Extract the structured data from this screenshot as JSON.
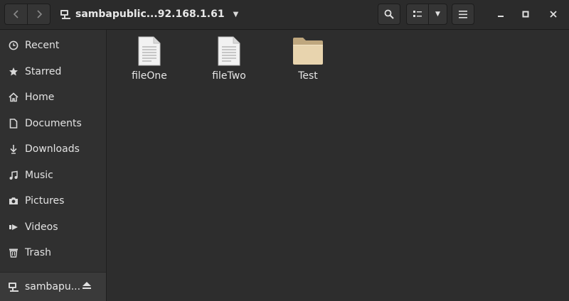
{
  "header": {
    "path_label": "sambapublic...92.168.1.61",
    "icons": {
      "back": "chevron-left-icon",
      "forward": "chevron-right-icon",
      "location": "network-drive-icon",
      "path_menu": "caret-down-icon",
      "search": "search-icon",
      "view": "view-list-icon",
      "view_menu": "caret-down-icon",
      "menu": "hamburger-icon",
      "minimize": "minimize-icon",
      "maximize": "maximize-icon",
      "close": "close-icon"
    }
  },
  "sidebar": {
    "items": [
      {
        "label": "Recent",
        "icon": "clock-icon"
      },
      {
        "label": "Starred",
        "icon": "star-icon"
      },
      {
        "label": "Home",
        "icon": "home-icon"
      },
      {
        "label": "Documents",
        "icon": "document-icon"
      },
      {
        "label": "Downloads",
        "icon": "download-icon"
      },
      {
        "label": "Music",
        "icon": "music-icon"
      },
      {
        "label": "Pictures",
        "icon": "camera-icon"
      },
      {
        "label": "Videos",
        "icon": "video-icon"
      },
      {
        "label": "Trash",
        "icon": "trash-icon"
      }
    ],
    "mount": {
      "label": "sambapu...",
      "icon": "network-drive-icon",
      "action_icon": "eject-icon"
    }
  },
  "files": [
    {
      "name": "fileOne",
      "type": "document"
    },
    {
      "name": "fileTwo",
      "type": "document"
    },
    {
      "name": "Test",
      "type": "folder"
    }
  ],
  "colors": {
    "background": "#2d2d2d",
    "sidebar": "#303030",
    "selected_mount": "#3a3a3a",
    "folder": "#e8d4ae",
    "document": "#f2f2f2"
  }
}
